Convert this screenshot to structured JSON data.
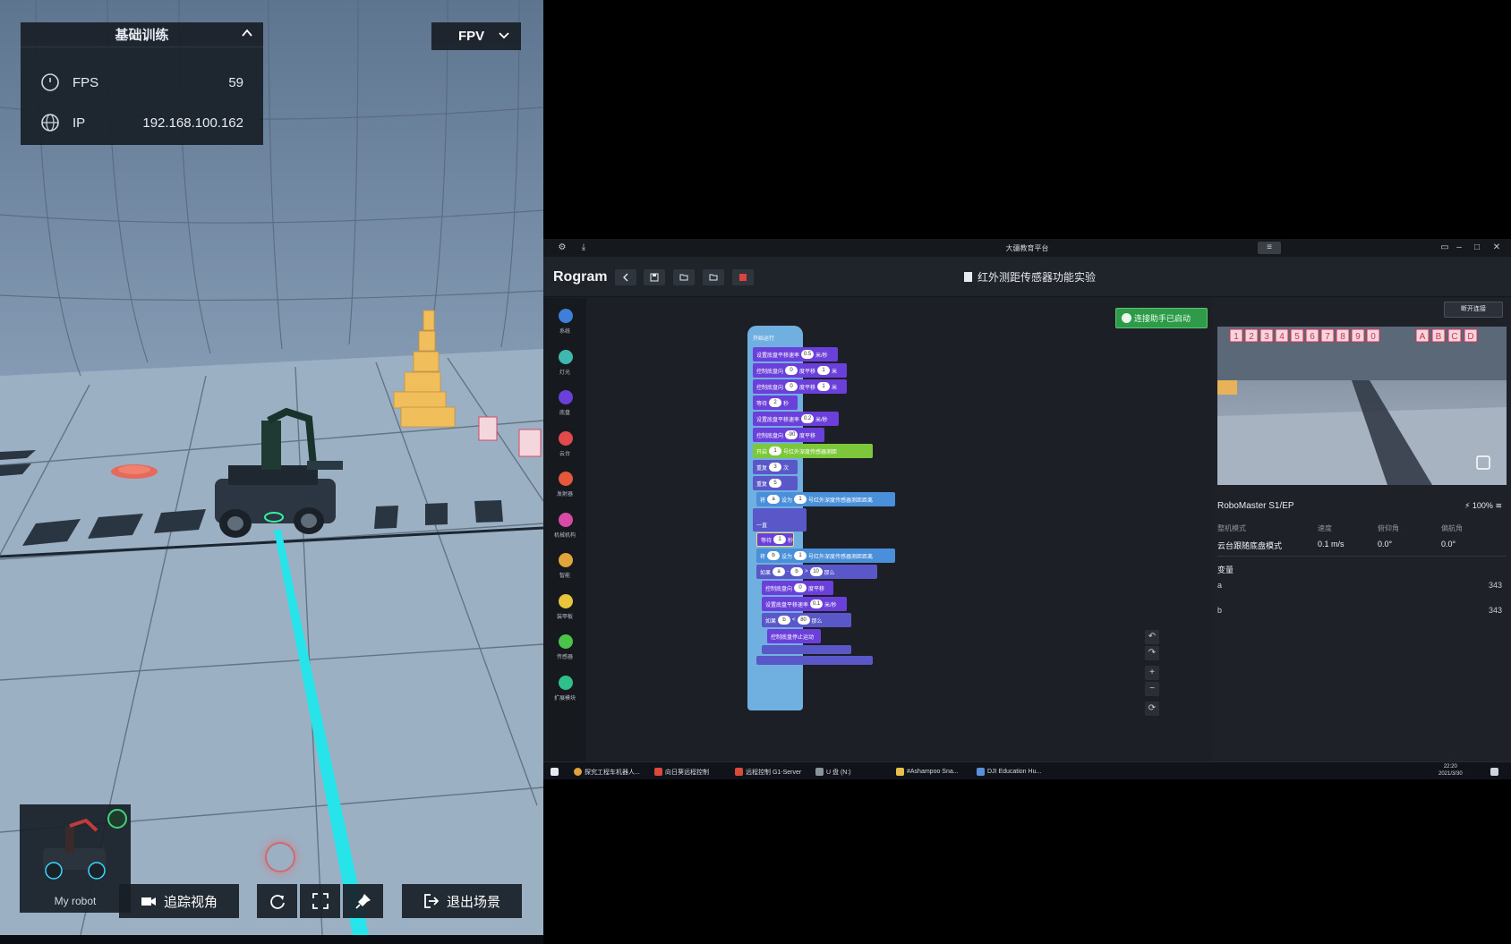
{
  "sim": {
    "panel_title": "基础训练",
    "fps_label": "FPS",
    "fps_value": "59",
    "ip_label": "IP",
    "ip_value": "192.168.100.162",
    "view_mode": "FPV",
    "robot_name": "My robot",
    "follow_view_label": "追踪视角",
    "exit_scene_label": "退出场景",
    "icons": [
      "dial-icon",
      "globe-icon",
      "chevron-up-icon",
      "chevron-down-icon",
      "camera-icon",
      "reset-icon",
      "fullscreen-icon",
      "pin-icon",
      "exit-icon"
    ]
  },
  "app": {
    "window_title": "大疆教育平台",
    "brand": "Rogram",
    "project_title": "红外测距传感器功能实验",
    "connection_status": "连接助手已启动",
    "disconnect_label": "断开连接",
    "palette": [
      {
        "label": "系统",
        "color": "#3d7fd9"
      },
      {
        "label": "灯光",
        "color": "#3fb8b0"
      },
      {
        "label": "底盘",
        "color": "#6b3fd9"
      },
      {
        "label": "云台",
        "color": "#e04a4a"
      },
      {
        "label": "发射器",
        "color": "#e5583a"
      },
      {
        "label": "机械机构",
        "color": "#d94aa6"
      },
      {
        "label": "智能",
        "color": "#e0a63a"
      },
      {
        "label": "装甲板",
        "color": "#e8c53a"
      },
      {
        "label": "传感器",
        "color": "#4cc44a"
      },
      {
        "label": "扩展模块",
        "color": "#2fbf8a"
      }
    ],
    "blocks": {
      "hat": "开始运行",
      "b1": "设置底盘平移速率",
      "b1_v": "0.5",
      "b1_u": "米/秒",
      "b2": "控制底盘向",
      "b2_v": "0",
      "b2_m": "度平移",
      "b2_v2": "1",
      "b2_u": "米",
      "b3": "控制底盘向",
      "b3_v": "0",
      "b3_m": "度平移",
      "b3_v2": "1",
      "b3_u": "米",
      "b4": "等待",
      "b4_v": "2",
      "b4_u": "秒",
      "b5": "设置底盘平移速率",
      "b5_v": "0.2",
      "b5_u": "米/秒",
      "b6": "控制底盘向",
      "b6_v": "-90",
      "b6_u": "度平移",
      "b7": "开启",
      "b7_v": "1",
      "b7_u": "号红外深度传感器测距",
      "b8": "重复",
      "b8_v": "3",
      "b8_u": "次",
      "b9": "重复",
      "b9_v": "5",
      "b10": "将",
      "b10_var": "a",
      "b10_m": "设为",
      "b10_v": "1",
      "b10_u": "号红外深度传感器测距距离",
      "b11": "一直",
      "b12": "等待",
      "b12_v": "1",
      "b12_u": "秒",
      "b13": "将",
      "b13_var": "b",
      "b13_m": "设为",
      "b13_v": "1",
      "b13_u": "号红外深度传感器测距距离",
      "b14": "如果",
      "b14_a": "a",
      "b14_b": "b",
      "b14_v": "10",
      "b14_u": "那么",
      "b15": "控制底盘向",
      "b15_v": "0",
      "b15_u": "度平移",
      "b16": "设置底盘平移速率",
      "b16_v": "0.1",
      "b16_u": "米/秒",
      "b17": "如果",
      "b17_a": "b",
      "b17_v": "80",
      "b17_u": "那么",
      "b18": "控制底盘停止运动"
    },
    "robot_model": "RoboMaster S1/EP",
    "battery": "100%",
    "stats_headers": [
      "整机模式",
      "速度",
      "俯仰角",
      "偏航角"
    ],
    "stats_values": [
      "云台跟随底盘模式",
      "0.1 m/s",
      "0.0°",
      "0.0°"
    ],
    "variables_title": "变量",
    "variables": [
      {
        "name": "a",
        "value": "343"
      },
      {
        "name": "b",
        "value": "343"
      }
    ],
    "cam_labels_top": [
      "1",
      "2",
      "3",
      "4",
      "5",
      "6",
      "7",
      "8",
      "9",
      "0",
      "A",
      "B",
      "C",
      "D"
    ],
    "taskbar": {
      "items": [
        "探究工程车机器人...",
        "向日葵远程控制",
        "远程控制 G1-Server",
        "U 盘 (N:)",
        "#Ashampoo Sna...",
        "DJI Education Hu..."
      ],
      "time": "22:20",
      "date": "2021/3/30"
    }
  }
}
